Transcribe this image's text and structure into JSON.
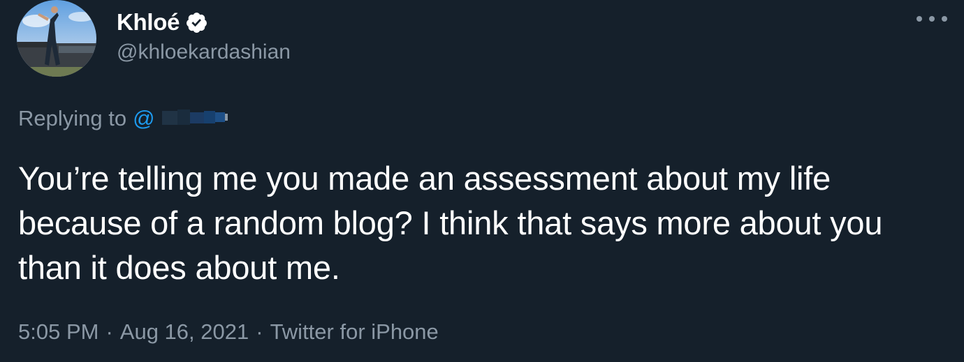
{
  "author": {
    "display_name": "Khloé",
    "handle": "@khloekardashian",
    "verified": true,
    "avatar_icon": "profile-photo"
  },
  "reply": {
    "prefix": "Replying to",
    "mention": "@"
  },
  "tweet": {
    "text": "You’re telling me you made an assessment about my life because of a random blog? I think that says more about you than it does about me."
  },
  "meta": {
    "time": "5:05 PM",
    "separator": "·",
    "date": "Aug 16, 2021",
    "source": "Twitter for iPhone"
  },
  "colors": {
    "background": "#15202b",
    "primary_text": "#ffffff",
    "secondary_text": "#8b98a5",
    "link": "#1d9bf0"
  }
}
